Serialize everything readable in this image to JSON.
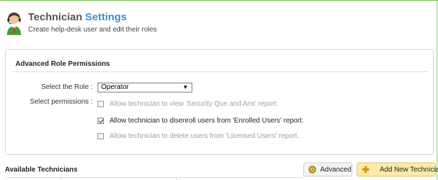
{
  "header": {
    "title_part1": "Technician",
    "title_part2": "Settings",
    "subtitle": "Create help-desk user and edit their roles",
    "icon": "technician-headset-icon"
  },
  "panel": {
    "title": "Advanced Role Permissions",
    "role_label": "Select the Role :",
    "role_value": "Operator",
    "permissions_label": "Select permissions :",
    "permissions": [
      {
        "label": "Allow technician to view 'Security Que and Ans' report.",
        "checked": false,
        "enabled": false
      },
      {
        "label": "Allow technician to disenroll users from 'Enrolled Users' report.",
        "checked": true,
        "enabled": true
      },
      {
        "label": "Allow technician to delete users from 'Licensed Users' report.",
        "checked": false,
        "enabled": false
      }
    ]
  },
  "technicians": {
    "title": "Available Technicians",
    "advanced_label": "Advanced",
    "add_label": "Add New Technician"
  },
  "colors": {
    "accent_blue": "#3d8fd1",
    "top_border_green": "#6cc04a",
    "add_button_bg": "#fbeaa8"
  }
}
